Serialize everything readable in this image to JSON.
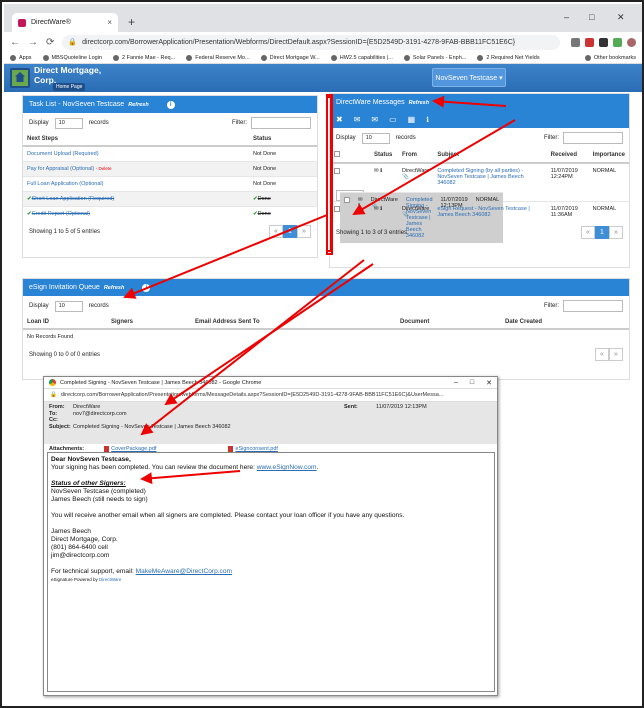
{
  "browser": {
    "tab_title": "DirectWare®",
    "tab_close": "×",
    "newtab": "+",
    "minimize": "–",
    "maximize": "□",
    "close": "✕",
    "url": "directcorp.com/BorrowerApplication/Presentation/Webforms/DirectDefault.aspx?SessionID={E5D2549D-3191-4278-9FAB-BBB11FC51E6C}"
  },
  "bookmarks": [
    "Apps",
    "MBSQuoteline Login",
    "2 Fannie Mae - Req...",
    "Federal Reserve Mo...",
    "Direct Mortgage W...",
    "HW2.5 capabilities |...",
    "Solar Panels - Enph...",
    "2 Required Net Yields",
    "Other bookmarks"
  ],
  "app": {
    "brand_line1": "Direct Mortgage,",
    "brand_line2": "Corp.",
    "home": "Home Page",
    "user": "NovSeven Testcase ▾"
  },
  "tasklist": {
    "title": "Task List - NovSeven Testcase",
    "refresh": "Refresh",
    "display": "Display",
    "display_val": "10",
    "records": "records",
    "filter": "Filter:",
    "headers": [
      "Next Steps",
      "Status"
    ],
    "rows": [
      {
        "step": "Document Upload (Required)",
        "status": "Not Done"
      },
      {
        "step": "Pay for Appraisal (Optional)",
        "extra": "- Delete",
        "status": "Not Done"
      },
      {
        "step": "Full Loan Application (Optional)",
        "status": "Not Done"
      },
      {
        "step": "Short Loan Application (Required)",
        "status": "Done"
      },
      {
        "step": "Credit Report (Optional)",
        "status": "Done"
      }
    ],
    "showing": "Showing 1 to 5 of 5 entries",
    "page": "1",
    "prev": "«",
    "next": "»"
  },
  "messages": {
    "title": "DirectWare Messages",
    "refresh": "Refresh",
    "display": "Display",
    "display_val": "10",
    "records": "records",
    "filter": "Filter:",
    "headers": [
      "Status",
      "From",
      "Subject",
      "Received",
      "Importance"
    ],
    "rows": [
      {
        "from": "DirectWare",
        "subject": "Completed Signing (by all parties) - NovSeven Testcase | James Beech 346082",
        "received": "11/07/2019 12:24PM",
        "importance": "NORMAL"
      },
      {
        "from": "DirectWare",
        "subject": "Completed Signing - NovSeven Testcase | James Beech 346082",
        "received": "11/07/2019 12:13PM",
        "importance": "NORMAL"
      },
      {
        "from": "DirectWare",
        "subject": "eSign Request - NovSeven Testcase | James Beech 346082",
        "received": "11/07/2019 11:36AM",
        "importance": "NORMAL"
      }
    ],
    "showing": "Showing 1 to 3 of 3 entries",
    "page": "1",
    "prev": "«",
    "next": "»"
  },
  "esign": {
    "title": "eSign Invitation Queue",
    "refresh": "Refresh",
    "display": "Display",
    "display_val": "10",
    "records": "records",
    "filter": "Filter:",
    "headers": [
      "Loan ID",
      "Signers",
      "Email Address Sent To",
      "Document",
      "Date Created"
    ],
    "empty": "No Records Found",
    "showing": "Showing 0 to 0 of 0 entries",
    "prev": "«",
    "next": "»"
  },
  "popup": {
    "title": "Completed Signing - NovSeven Testcase | James Beech 346082 - Google Chrome",
    "url": "directcorp.com/BorrowerApplication/Presentation/webforms/MessageDetails.aspx?SessionID={E5D2549D-3191-4278-9FAB-BBB11FC51E6C}&UserMessa...",
    "from_label": "From:",
    "from": "DirectWare",
    "to_label": "To:",
    "to": "nov7@directcorp.com",
    "cc_label": "Cc:",
    "subject_label": "Subject:",
    "subject": "Completed Signing - NovSeven Testcase | James Beech 346082",
    "sent_label": "Sent:",
    "sent": "11/07/2019 12:13PM",
    "attach_label": "Attachments:",
    "attach1": "CoverPackage.pdf",
    "attach2": "eSignconsent.pdf",
    "greeting": "Dear NovSeven Testcase,",
    "line1": "Your signing has been completed. You can review the document here:",
    "link1": "www.eSignNow.com",
    "line1_end": ".",
    "status_heading": "Status of other Signers:",
    "signer1": "NovSeven Testcase (completed)",
    "signer2": "James Beech (still needs to sign)",
    "line2": "You will receive another email when all signers are completed. Please contact your loan officer if you have any questions.",
    "sig1": "James Beech",
    "sig2": "Direct Mortgage, Corp.",
    "sig3": "(801) 864-6400 cell",
    "sig4": "jim@directcorp.com",
    "support": "For technical support, email:",
    "support_email": "MakeMeAware@DirectCorp.com",
    "powered": "eSignature Powered by",
    "powered_brand": "DirectWare"
  }
}
